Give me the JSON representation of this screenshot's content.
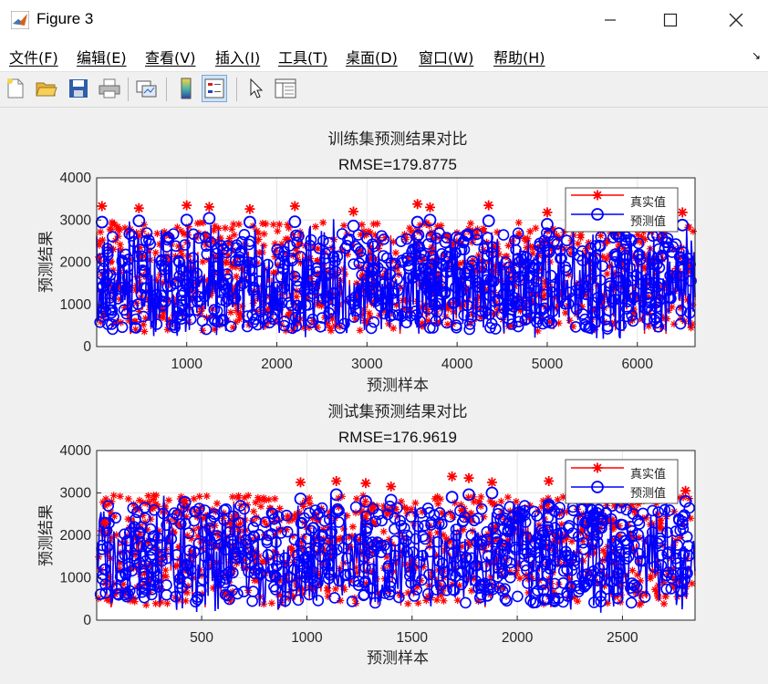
{
  "window": {
    "title": "Figure 3"
  },
  "menu": [
    {
      "label": "文件(F)"
    },
    {
      "label": "编辑(E)"
    },
    {
      "label": "查看(V)"
    },
    {
      "label": "插入(I)"
    },
    {
      "label": "工具(T)"
    },
    {
      "label": "桌面(D)"
    },
    {
      "label": "窗口(W)"
    },
    {
      "label": "帮助(H)"
    }
  ],
  "toolbar": [
    "new-figure-icon",
    "open-icon",
    "save-icon",
    "print-icon",
    "link-plot-icon",
    "colorbar-icon",
    "legend-icon",
    "edit-plot-icon",
    "property-inspector-icon"
  ],
  "colors": {
    "real": "#ff0000",
    "pred": "#0000ff"
  },
  "chart_data": [
    {
      "type": "line",
      "title": "训练集预测结果对比",
      "subtitle": "RMSE=179.8775",
      "xlabel": "预测样本",
      "ylabel": "预测结果",
      "xlim": [
        1,
        6640
      ],
      "ylim": [
        0,
        4000
      ],
      "xticks": [
        1000,
        2000,
        3000,
        4000,
        5000,
        6000
      ],
      "yticks": [
        0,
        1000,
        2000,
        3000,
        4000
      ],
      "grid": true,
      "legend_position": "top-right",
      "series": [
        {
          "name": "真实值",
          "marker": "*",
          "color": "#ff0000",
          "x": [
            60,
            470,
            1000,
            1250,
            1700,
            2200,
            2850,
            3560,
            3700,
            4350,
            5000,
            5900,
            6500
          ],
          "values": [
            3330,
            3280,
            3350,
            3310,
            3260,
            3330,
            3200,
            3380,
            3300,
            3350,
            3180,
            3320,
            3180
          ]
        },
        {
          "name": "预测值",
          "marker": "o",
          "color": "#0000ff",
          "x": [
            60,
            470,
            1000,
            1250,
            1700,
            2200,
            2850,
            3560,
            3700,
            4350,
            5000,
            5900,
            6500
          ],
          "values": [
            2950,
            2980,
            3000,
            3040,
            2950,
            2960,
            2860,
            2950,
            3000,
            2980,
            2900,
            3000,
            2880
          ]
        }
      ]
    },
    {
      "type": "line",
      "title": "测试集预测结果对比",
      "subtitle": "RMSE=176.9619",
      "xlabel": "预测样本",
      "ylabel": "预测结果",
      "xlim": [
        1,
        2845
      ],
      "ylim": [
        0,
        4000
      ],
      "xticks": [
        500,
        1000,
        1500,
        2000,
        2500
      ],
      "yticks": [
        0,
        1000,
        2000,
        3000,
        4000
      ],
      "grid": true,
      "legend_position": "top-right",
      "series": [
        {
          "name": "真实值",
          "marker": "*",
          "color": "#ff0000",
          "x": [
            40,
            420,
            970,
            1140,
            1280,
            1400,
            1690,
            1770,
            1880,
            2150,
            2500,
            2800
          ],
          "values": [
            2300,
            2820,
            3250,
            3280,
            3230,
            3150,
            3390,
            3350,
            3250,
            3280,
            3100,
            3050
          ]
        },
        {
          "name": "预测值",
          "marker": "o",
          "color": "#0000ff",
          "x": [
            40,
            420,
            970,
            1140,
            1280,
            1400,
            1690,
            1770,
            1880,
            2150,
            2500,
            2800
          ],
          "values": [
            2290,
            2780,
            2860,
            2960,
            2800,
            2830,
            2900,
            2960,
            3000,
            2720,
            2800,
            2800
          ]
        }
      ]
    }
  ]
}
